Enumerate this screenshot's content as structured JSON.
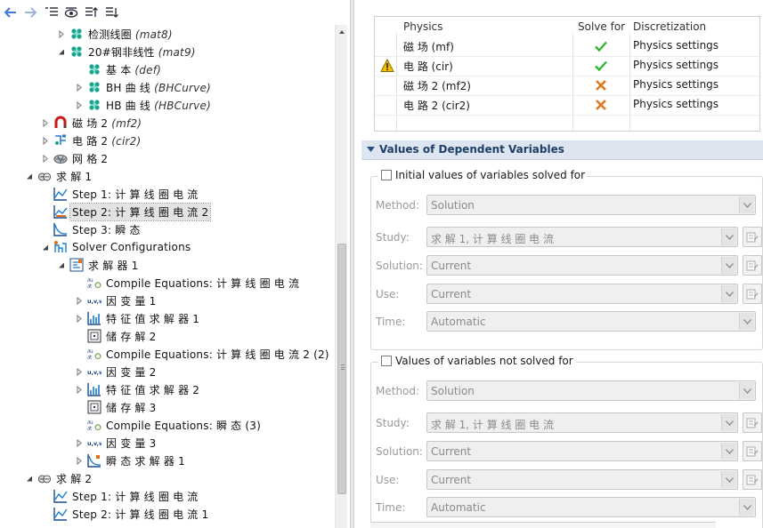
{
  "tree": {
    "rows": [
      {
        "label": "检测线圈",
        "tag": "(mat8)"
      },
      {
        "label": "20#钢非线性",
        "tag": "(mat9)"
      },
      {
        "label": "基 本",
        "tag": "(def)"
      },
      {
        "label": "BH 曲 线",
        "tag": "(BHCurve)"
      },
      {
        "label": "HB 曲 线",
        "tag": "(HBCurve)"
      },
      {
        "label": "磁 场 2",
        "tag": "(mf2)"
      },
      {
        "label": "电 路 2",
        "tag": "(cir2)"
      },
      {
        "label": "网 格 2",
        "tag": ""
      },
      {
        "label": "求 解 1",
        "tag": ""
      },
      {
        "label": "Step 1: 计 算 线 圈 电 流",
        "tag": ""
      },
      {
        "label": "Step 2: 计 算 线 圈 电 流 2",
        "tag": ""
      },
      {
        "label": "Step 3: 瞬 态",
        "tag": ""
      },
      {
        "label": "Solver Configurations",
        "tag": ""
      },
      {
        "label": "求 解 器 1",
        "tag": ""
      },
      {
        "label": "Compile Equations: 计 算 线 圈 电 流",
        "tag": ""
      },
      {
        "label": "因 变 量 1",
        "tag": ""
      },
      {
        "label": "特 征 值 求 解 器 1",
        "tag": ""
      },
      {
        "label": "储 存 解 2",
        "tag": ""
      },
      {
        "label": "Compile Equations: 计 算 线 圈 电 流 2 (2)",
        "tag": ""
      },
      {
        "label": "因 变 量 2",
        "tag": ""
      },
      {
        "label": "特 征 值 求 解 器 2",
        "tag": ""
      },
      {
        "label": "储 存 解 3",
        "tag": ""
      },
      {
        "label": "Compile Equations: 瞬 态 (3)",
        "tag": ""
      },
      {
        "label": "因 变 量 3",
        "tag": ""
      },
      {
        "label": "瞬 态 求 解 器 1",
        "tag": ""
      },
      {
        "label": "求 解 2",
        "tag": ""
      },
      {
        "label": "Step 1: 计 算 线 圈 电 流",
        "tag": ""
      },
      {
        "label": "Step 2: 计 算 线 圈 电 流 1",
        "tag": ""
      }
    ]
  },
  "physics_table": {
    "headers": {
      "physics": "Physics",
      "solve_for": "Solve for",
      "discretization": "Discretization"
    },
    "rows": [
      {
        "name": "磁 场 (mf)",
        "solve": "check",
        "disc": "Physics settings"
      },
      {
        "name": "电 路 (cir)",
        "solve": "check",
        "disc": "Physics settings"
      },
      {
        "name": "磁 场 2 (mf2)",
        "solve": "cross",
        "disc": "Physics settings"
      },
      {
        "name": "电 路 2 (cir2)",
        "solve": "cross",
        "disc": "Physics settings"
      }
    ]
  },
  "section": {
    "title": "Values of Dependent Variables"
  },
  "groups": [
    {
      "title": "Initial values of variables solved for",
      "fields": [
        {
          "label": "Method:",
          "value": "Solution"
        },
        {
          "label": "Study:",
          "value": "求 解 1, 计 算 线 圈 电 流"
        },
        {
          "label": "Solution:",
          "value": "Current"
        },
        {
          "label": "Use:",
          "value": "Current"
        },
        {
          "label": "Time:",
          "value": "Automatic"
        }
      ]
    },
    {
      "title": "Values of variables not solved for",
      "fields": [
        {
          "label": "Method:",
          "value": "Solution"
        },
        {
          "label": "Study:",
          "value": "求 解 1, 计 算 线 圈 电 流"
        },
        {
          "label": "Solution:",
          "value": "Current"
        },
        {
          "label": "Use:",
          "value": "Current"
        },
        {
          "label": "Time:",
          "value": "Automatic"
        }
      ]
    }
  ],
  "icons": {
    "toolbar": [
      "back-arrow-icon",
      "forward-arrow-icon",
      "show-list-icon",
      "view-icon",
      "sort-up-icon",
      "sort-down-icon"
    ]
  },
  "colors": {
    "accent": "#1f3f66",
    "check": "#2fb62f",
    "cross": "#e07820",
    "warning": "#f2c200"
  }
}
